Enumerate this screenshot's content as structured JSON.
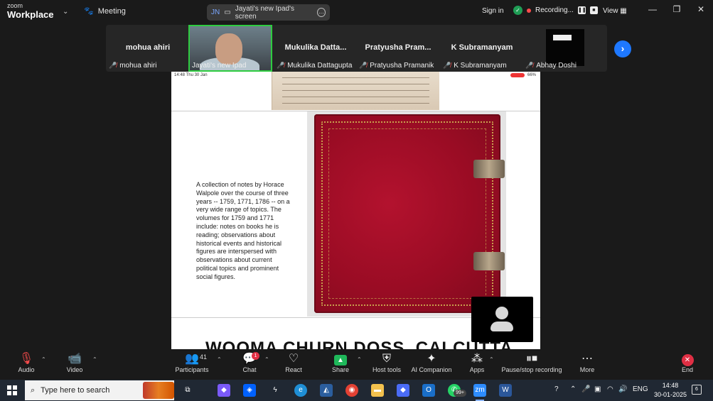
{
  "app": {
    "brand_top": "zoom",
    "brand_bottom": "Workplace",
    "meeting_label": "Meeting"
  },
  "share": {
    "initials": "JN",
    "label": "Jayati's new Ipad's screen"
  },
  "topright": {
    "signin": "Sign in",
    "recording": "Recording...",
    "view": "View"
  },
  "participants": [
    {
      "big": "mohua ahiri",
      "small": "mohua ahiri"
    },
    {
      "big": "",
      "small": "Jayati's new Ipad"
    },
    {
      "big": "Mukulika  Datta...",
      "small": "Mukulika Dattagupta"
    },
    {
      "big": "Pratyusha  Pram...",
      "small": "Pratyusha Pramanik"
    },
    {
      "big": "K Subramanyam",
      "small": "K Subramanyam"
    },
    {
      "big": "",
      "small": "Abhay Doshi"
    }
  ],
  "slide": {
    "status_left": "14:48   Thu 30 Jan",
    "status_right": "66%",
    "notes": "A collection of notes by Horace Walpole over the course of three years -- 1759, 1771, 1786 -- on a very wide range of topics. The volumes for 1759 and 1771 include: notes on books he is reading; observations about historical events and historical figures are interspersed with observations about current political topics and prominent social figures.",
    "bottom_heading": "WOOMA CHURN DOSS, CALCUTTA"
  },
  "toolbar": {
    "audio": "Audio",
    "video": "Video",
    "participants": "Participants",
    "participants_count": "41",
    "chat": "Chat",
    "chat_badge": "1",
    "react": "React",
    "share": "Share",
    "host_tools": "Host tools",
    "ai_companion": "AI Companion",
    "apps": "Apps",
    "pause_stop": "Pause/stop recording",
    "more": "More",
    "end": "End"
  },
  "taskbar": {
    "search_placeholder": "Type here to search",
    "lang": "ENG",
    "time": "14:48",
    "date": "30-01-2025",
    "notif_count": "6",
    "whatsapp_badge": "99+"
  },
  "colors": {
    "accent": "#1e78ff",
    "active_speaker": "#2ecc40",
    "end": "#e02f44",
    "share": "#1fb85a"
  }
}
